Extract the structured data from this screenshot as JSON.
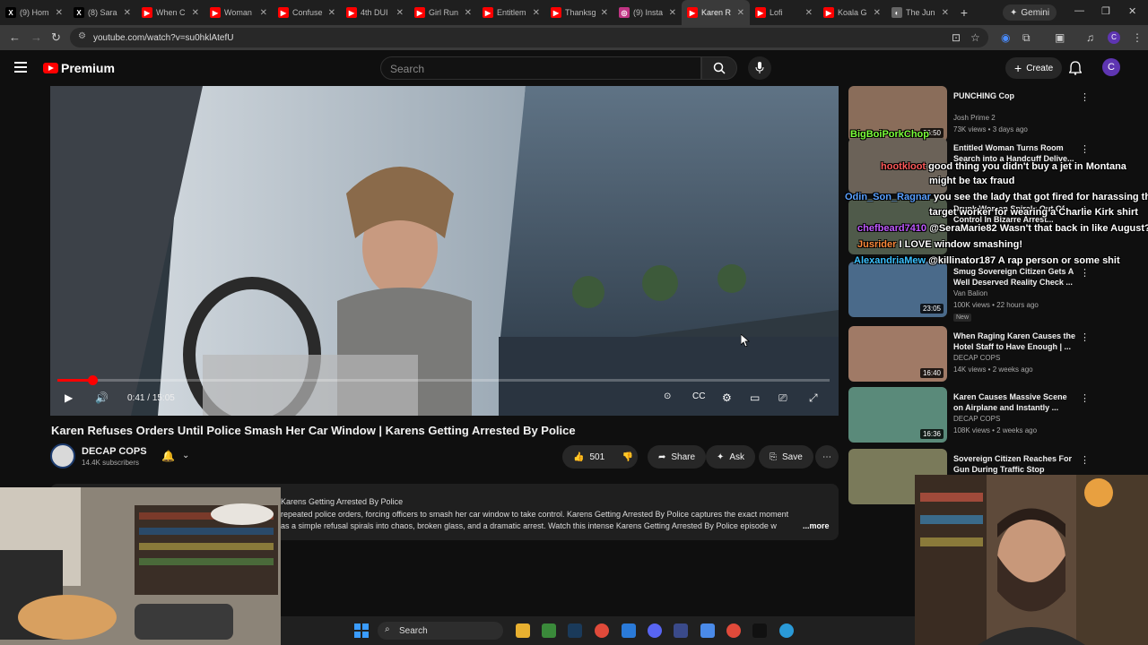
{
  "browser": {
    "tabs": [
      {
        "label": "(9) Hom",
        "fav": "X",
        "color": "#000000"
      },
      {
        "label": "(8) Sara",
        "fav": "X",
        "color": "#000000"
      },
      {
        "label": "When C",
        "fav": "▶",
        "color": "#ff0000"
      },
      {
        "label": "Woman",
        "fav": "▶",
        "color": "#ff0000"
      },
      {
        "label": "Confuse",
        "fav": "▶",
        "color": "#ff0000"
      },
      {
        "label": "4th DUI",
        "fav": "▶",
        "color": "#ff0000"
      },
      {
        "label": "Girl Run",
        "fav": "▶",
        "color": "#ff0000"
      },
      {
        "label": "Entitlem",
        "fav": "▶",
        "color": "#ff0000"
      },
      {
        "label": "Thanksg",
        "fav": "▶",
        "color": "#ff0000"
      },
      {
        "label": "(9) Insta",
        "fav": "◎",
        "color": "#c13584"
      },
      {
        "label": "Karen R",
        "fav": "▶",
        "color": "#ff0000"
      },
      {
        "label": "Lofi",
        "fav": "▶",
        "color": "#ff0000"
      },
      {
        "label": "Koala G",
        "fav": "▶",
        "color": "#ff0000"
      },
      {
        "label": "The Jun",
        "fav": "◐",
        "color": "#666666"
      }
    ],
    "active_tab": 10,
    "gemini_label": "Gemini",
    "url": "youtube.com/watch?v=su0hklAtefU"
  },
  "youtube": {
    "logo_text": "Premium",
    "search_placeholder": "Search",
    "create_label": "Create",
    "avatar_letter": "C"
  },
  "video": {
    "time_current": "0:41",
    "time_total": "15:05",
    "progress_fraction": 0.045,
    "title": "Karen Refuses Orders Until Police Smash Her Car Window | Karens Getting Arrested By Police",
    "channel": "DECAP COPS",
    "subscribers": "14.4K subscribers",
    "likes": "501",
    "share_label": "Share",
    "ask_label": "Ask",
    "save_label": "Save",
    "desc_line1": "Karens Getting Arrested By Police",
    "desc_line2": "repeated police orders, forcing officers to smash her car window to take control. Karens Getting Arrested By Police captures the exact moment",
    "desc_line3": "as a simple refusal spirals into chaos, broken glass, and a dramatic arrest. Watch this intense Karens Getting Arrested By Police episode w",
    "desc_more": "...more"
  },
  "sidebar": [
    {
      "title": "PUNCHING Cop",
      "channel": "Josh Prime 2",
      "meta": "73K views • 3 days ago",
      "duration": "26:50",
      "thumb": "#8a6d5a"
    },
    {
      "title": "Entitled Woman Turns Room Search into a Handcuff Delive...",
      "channel": "",
      "meta": "",
      "duration": "",
      "thumb": "#6b6258"
    },
    {
      "title": "Drunk Woman Spirals Out Of Control In Bizarre Arrest...",
      "channel": "",
      "meta": "",
      "duration": "",
      "thumb": "#4f5a4a"
    },
    {
      "title": "Smug Sovereign Citizen Gets A Well Deserved Reality Check ...",
      "channel": "Van Balion",
      "meta": "100K views • 22 hours ago",
      "duration": "23:05",
      "thumb": "#4a6a8a",
      "new": "New"
    },
    {
      "title": "When Raging Karen Causes the Hotel Staff to Have Enough | ...",
      "channel": "DECAP COPS",
      "meta": "14K views • 2 weeks ago",
      "duration": "16:40",
      "thumb": "#a07a66"
    },
    {
      "title": "Karen Causes Massive Scene on Airplane and Instantly ...",
      "channel": "DECAP COPS",
      "meta": "108K views • 2 weeks ago",
      "duration": "16:36",
      "thumb": "#5a8a7a"
    },
    {
      "title": "Sovereign Citizen Reaches For Gun During Traffic Stop",
      "channel": "",
      "meta": "",
      "duration": "",
      "thumb": "#7a7a5a"
    }
  ],
  "chat": [
    {
      "user": "BigBoiPorkChop",
      "text": "",
      "color": "#7cff3a"
    },
    {
      "user": "hootkloot",
      "text": "good thing you didn't buy a jet in Montana",
      "color": "#ff5a5a"
    },
    {
      "user": "",
      "text": "might be tax fraud",
      "color": "#ffffff"
    },
    {
      "user": "Odin_Son_Ragnar",
      "text": "you see the lady that got fired for harassing the",
      "color": "#5aa0ff"
    },
    {
      "user": "",
      "text": "target worker for wearing a Charlie Kirk shirt",
      "color": "#ffffff"
    },
    {
      "user": "chefbeard7410",
      "text": "@SeraMarie82 Wasn't that back in like August?",
      "color": "#c05aff"
    },
    {
      "user": "Jusrider",
      "text": "I LOVE window smashing!",
      "color": "#ff8a3a"
    },
    {
      "user": "AlexandriaMew",
      "text": "@killinator187 A rap person or some shit",
      "color": "#3ac0ff"
    }
  ],
  "taskbar": {
    "search_label": "Search"
  },
  "colors": {
    "accent_red": "#ff0000",
    "bg": "#0f0f0f",
    "surface": "#272727"
  }
}
